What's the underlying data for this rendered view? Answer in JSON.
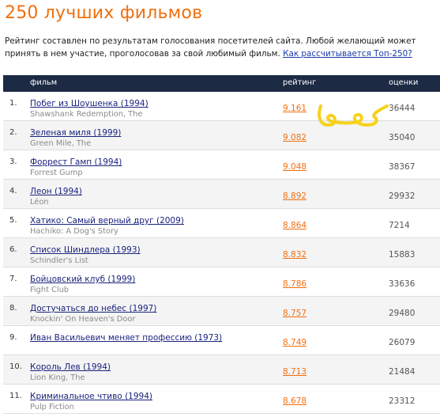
{
  "page": {
    "title": "250 лучших фильмов",
    "intro_text": "Рейтинг составлен по результатам голосования посетителей сайта. Любой желающий может принять в нем участие, проголосовав за свой любимый фильм. ",
    "intro_link": "Как рассчитывается Топ-250?"
  },
  "table": {
    "headers": {
      "film": "фильм",
      "rating": "рейтинг",
      "votes": "оценки"
    },
    "rows": [
      {
        "rank": "1.",
        "title_ru": "Побег из Шоушенка (1994)",
        "title_orig": "Shawshank Redemption, The",
        "rating": "9.161",
        "votes": "36444"
      },
      {
        "rank": "2.",
        "title_ru": "Зеленая миля (1999)",
        "title_orig": "Green Mile, The",
        "rating": "9.082",
        "votes": "35040"
      },
      {
        "rank": "3.",
        "title_ru": "Форрест Гамп (1994)",
        "title_orig": "Forrest Gump",
        "rating": "9.048",
        "votes": "38367"
      },
      {
        "rank": "4.",
        "title_ru": "Леон (1994)",
        "title_orig": "Léon",
        "rating": "8.892",
        "votes": "29932"
      },
      {
        "rank": "5.",
        "title_ru": "Хатико: Самый верный друг (2009)",
        "title_orig": "Hachiko: A Dog's Story",
        "rating": "8.864",
        "votes": "7214"
      },
      {
        "rank": "6.",
        "title_ru": "Список Шиндлера (1993)",
        "title_orig": "Schindler's List",
        "rating": "8.832",
        "votes": "15883"
      },
      {
        "rank": "7.",
        "title_ru": "Бойцовский клуб (1999)",
        "title_orig": "Fight Club",
        "rating": "8.786",
        "votes": "33636"
      },
      {
        "rank": "8.",
        "title_ru": "Достучаться до небес (1997)",
        "title_orig": "Knockin' On Heaven's Door",
        "rating": "8.757",
        "votes": "29480"
      },
      {
        "rank": "9.",
        "title_ru": "Иван Васильевич меняет профессию (1973)",
        "title_orig": "",
        "rating": "8.749",
        "votes": "26079"
      },
      {
        "rank": "10.",
        "title_ru": "Король Лев (1994)",
        "title_orig": "Lion King, The",
        "rating": "8.713",
        "votes": "21484"
      },
      {
        "rank": "11.",
        "title_ru": "Криминальное чтиво (1994)",
        "title_orig": "Pulp Fiction",
        "rating": "8.678",
        "votes": "23312"
      }
    ]
  },
  "colors": {
    "accent": "#f26f0f",
    "header_bg": "#1c2a44",
    "link": "#1a237e",
    "scribble": "#f7d21a"
  }
}
